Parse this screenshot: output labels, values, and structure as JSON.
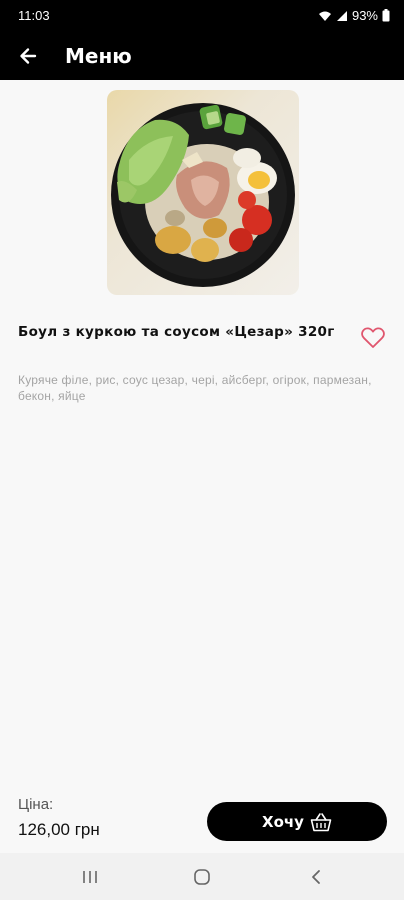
{
  "status_bar": {
    "time": "11:03",
    "battery": "93%"
  },
  "header": {
    "title": "Меню"
  },
  "product": {
    "name": "Боул з куркою та соусом «Цезар» 320г",
    "description": "Куряче філе, рис, соус цезар, чері, айсберг, огірок, пармезан, бекон, яйце",
    "image_icon": "salad-bowl-photo"
  },
  "footer": {
    "price_label": "Ціна:",
    "price": "126,00 грн",
    "want_button": "Хочу"
  },
  "colors": {
    "bar": "#000000",
    "background": "#f8f8f8",
    "favorite": "#e0566e",
    "muted_text": "#a4a4a4"
  }
}
